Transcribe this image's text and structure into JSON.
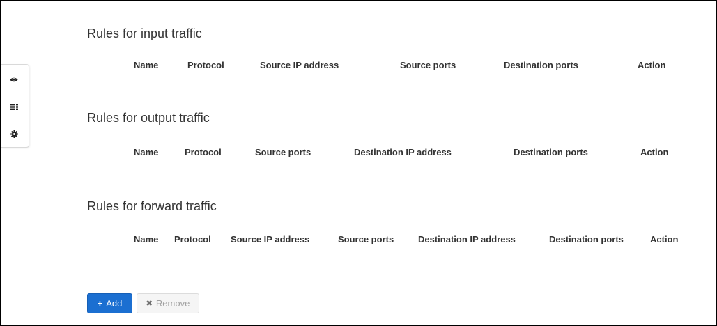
{
  "side_toolbar": {
    "items": [
      {
        "icon": "eye-icon"
      },
      {
        "icon": "grid-icon"
      },
      {
        "icon": "gear-icon"
      }
    ]
  },
  "sections": {
    "input": {
      "title": "Rules for input traffic",
      "columns": [
        "Name",
        "Protocol",
        "Source IP address",
        "Source ports",
        "Destination ports",
        "Action"
      ]
    },
    "output": {
      "title": "Rules for output traffic",
      "columns": [
        "Name",
        "Protocol",
        "Source ports",
        "Destination IP address",
        "Destination ports",
        "Action"
      ]
    },
    "forward": {
      "title": "Rules for forward traffic",
      "columns": [
        "Name",
        "Protocol",
        "Source IP address",
        "Source ports",
        "Destination IP address",
        "Destination ports",
        "Action"
      ]
    }
  },
  "actions": {
    "add_glyph": "+",
    "add_label": "Add",
    "remove_glyph": "✖",
    "remove_label": "Remove"
  },
  "colors": {
    "primary_button": "#1b6fd1",
    "disabled_button": "#f5f5f5",
    "text": "#333333"
  }
}
